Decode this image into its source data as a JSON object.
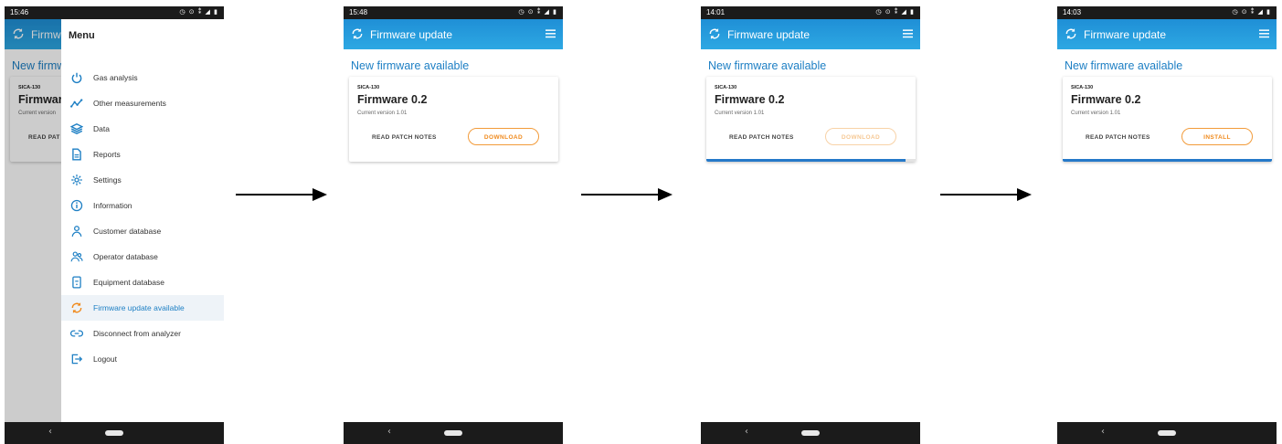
{
  "screens": [
    {
      "time": "15:46",
      "title": "Firmw",
      "heading": "New firmw",
      "model": "SICA-130",
      "firmware": "Firmware",
      "current": "Current version",
      "notes": "READ PAT"
    },
    {
      "time": "15:48",
      "title": "Firmware update",
      "heading": "New firmware available",
      "model": "SICA-130",
      "firmware": "Firmware 0.2",
      "current": "Current version 1.01",
      "notes": "READ PATCH NOTES",
      "action": "DOWNLOAD",
      "action_state": "enabled"
    },
    {
      "time": "14:01",
      "title": "Firmware update",
      "heading": "New firmware available",
      "model": "SICA-130",
      "firmware": "Firmware 0.2",
      "current": "Current version 1.01",
      "notes": "READ PATCH NOTES",
      "action": "DOWNLOAD",
      "action_state": "disabled",
      "progress": 0.95
    },
    {
      "time": "14:03",
      "title": "Firmware update",
      "heading": "New firmware available",
      "model": "SICA-130",
      "firmware": "Firmware 0.2",
      "current": "Current version 1.01",
      "notes": "READ PATCH NOTES",
      "action": "INSTALL",
      "action_state": "enabled",
      "progress": 1.0
    }
  ],
  "status_icons": "◷ ⊙ ⁑ ◢ ▮",
  "menu": {
    "title": "Menu",
    "items": [
      {
        "label": "Gas analysis",
        "icon": "power-icon"
      },
      {
        "label": "Other measurements",
        "icon": "line-chart-icon"
      },
      {
        "label": "Data",
        "icon": "layers-icon"
      },
      {
        "label": "Reports",
        "icon": "document-icon"
      },
      {
        "label": "Settings",
        "icon": "gear-icon"
      },
      {
        "label": "Information",
        "icon": "info-icon"
      },
      {
        "label": "Customer database",
        "icon": "person-icon"
      },
      {
        "label": "Operator database",
        "icon": "people-icon"
      },
      {
        "label": "Equipment database",
        "icon": "device-icon"
      },
      {
        "label": "Firmware update available",
        "icon": "refresh-icon",
        "active": true
      },
      {
        "label": "Disconnect from analyzer",
        "icon": "link-icon"
      },
      {
        "label": "Logout",
        "icon": "logout-icon"
      }
    ]
  },
  "colors": {
    "accent": "#1d7fc4",
    "appbar": "#2196db",
    "action": "#f08a1c",
    "progress": "#2579c9"
  }
}
